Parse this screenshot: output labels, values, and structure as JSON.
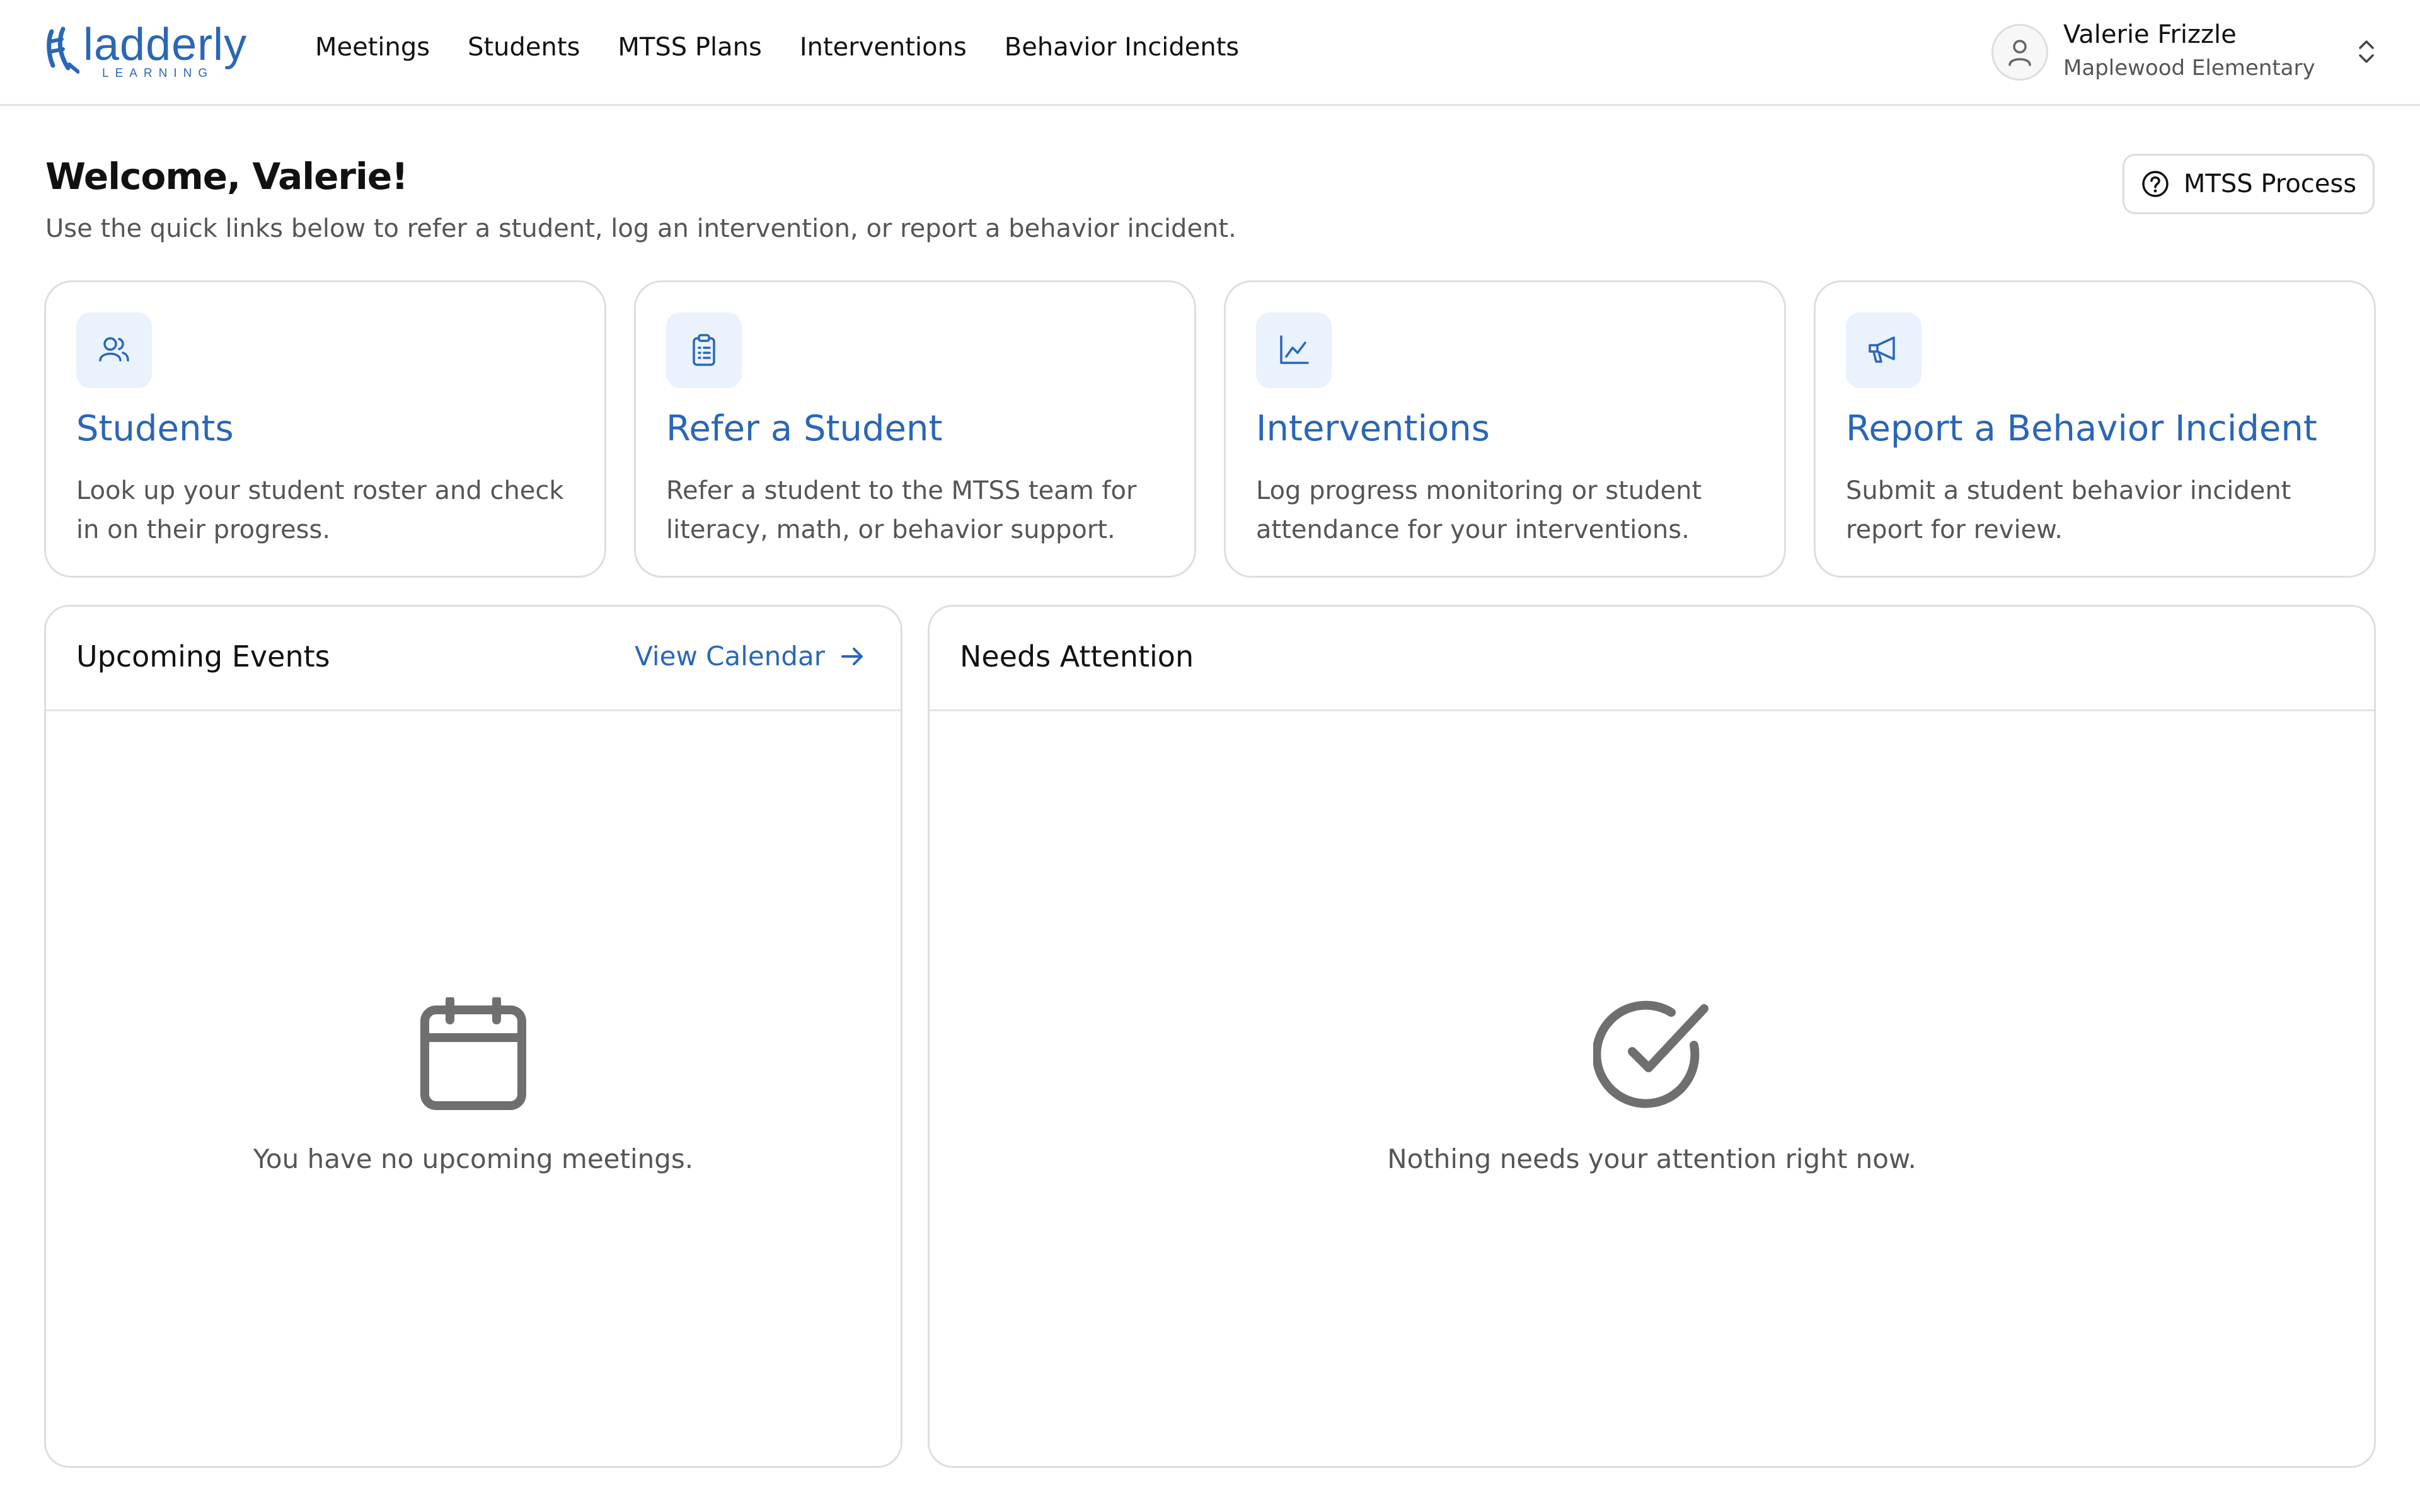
{
  "brand": {
    "name": "ladderly",
    "tagline": "LEARNING",
    "color": "#2a66b8"
  },
  "nav": {
    "items": [
      "Meetings",
      "Students",
      "MTSS Plans",
      "Interventions",
      "Behavior Incidents"
    ]
  },
  "user": {
    "name": "Valerie Frizzle",
    "school": "Maplewood Elementary"
  },
  "header": {
    "title": "Welcome, Valerie!",
    "subtitle": "Use the quick links below to refer a student, log an intervention, or report a behavior incident.",
    "process_button": "MTSS Process"
  },
  "cards": [
    {
      "title": "Students",
      "description": "Look up your student roster and check in on their progress.",
      "icon": "users-icon"
    },
    {
      "title": "Refer a Student",
      "description": "Refer a student to the MTSS team for literacy, math, or behavior support.",
      "icon": "clipboard-icon"
    },
    {
      "title": "Interventions",
      "description": "Log progress monitoring or student attendance for your interventions.",
      "icon": "line-chart-icon"
    },
    {
      "title": "Report a Behavior Incident",
      "description": "Submit a student behavior incident report for review.",
      "icon": "megaphone-icon"
    }
  ],
  "events": {
    "title": "Upcoming Events",
    "link": "View Calendar",
    "empty": "You have no upcoming meetings."
  },
  "attention": {
    "title": "Needs Attention",
    "empty": "Nothing needs your attention right now."
  },
  "colors": {
    "accent": "#2a66b8",
    "icon_bg": "#e9f2fd",
    "border": "#dedede",
    "muted": "#555555"
  }
}
